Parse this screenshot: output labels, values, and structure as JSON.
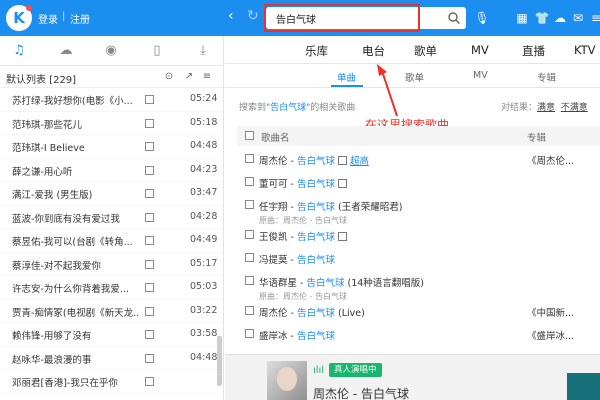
{
  "header": {
    "logo": "K",
    "login": "登录",
    "register": "注册",
    "search_value": "告白气球",
    "icons": [
      "mic-icon",
      "grid-icon",
      "skin-icon",
      "cloud-icon",
      "mail-icon",
      "menu-icon",
      "minimize-icon"
    ]
  },
  "left": {
    "tabs": [
      "music-note-icon",
      "cloud-icon",
      "radio-icon",
      "phone-icon",
      "download-icon"
    ],
    "list_title": "默认列表 [229]",
    "songs": [
      {
        "name": "苏打绿-我好想你(电影《小...",
        "dur": "05:24"
      },
      {
        "name": "范玮琪-那些花儿",
        "dur": "05:18"
      },
      {
        "name": "范玮琪-I Believe",
        "dur": "04:48"
      },
      {
        "name": "薛之谦-用心听",
        "dur": "04:23"
      },
      {
        "name": "满江-爱我 (男生版)",
        "dur": "03:47"
      },
      {
        "name": "蓝波-你到底有没有爱过我",
        "dur": "04:28"
      },
      {
        "name": "蔡昱佑-我可以(台剧《转角...",
        "dur": "04:49"
      },
      {
        "name": "蔡淳佳-对不起我爱你",
        "dur": "05:17"
      },
      {
        "name": "许志安-为什么你背着我爱...",
        "dur": "05:03"
      },
      {
        "name": "贾青-痴情冢(电视剧《新天龙...",
        "dur": "03:22"
      },
      {
        "name": "赖伟锋-用够了没有",
        "dur": "03:58"
      },
      {
        "name": "赵咏华-最浪漫的事",
        "dur": "04:48"
      },
      {
        "name": "邓丽君[香港]-我只在乎你",
        "dur": ""
      }
    ]
  },
  "main": {
    "tabs": [
      "乐库",
      "电台",
      "歌单",
      "MV",
      "直播",
      "KTV"
    ],
    "subtabs": [
      "单曲",
      "歌单",
      "MV",
      "专辑"
    ],
    "search_prefix": "搜索到",
    "search_kw": "\"告白气球\"",
    "search_suffix": "的相关歌曲",
    "result_right_label": "对结果：",
    "satisfied": "满意",
    "unsatisfied": "不满意",
    "note": "在这里搜索歌曲",
    "col_song": "歌曲名",
    "col_album": "专辑",
    "rows": [
      {
        "artist": "周杰伦 - ",
        "kw": "告白气球",
        "extra": "",
        "mv": true,
        "hq": "超高",
        "sub": "",
        "album": "《周杰伦..."
      },
      {
        "artist": "董可可 - ",
        "kw": "告白气球",
        "extra": "",
        "mv": true,
        "hq": "",
        "sub": "",
        "album": ""
      },
      {
        "artist": "任宇翔 - ",
        "kw": "告白气球",
        "extra": " (王者荣耀昭君)",
        "mv": false,
        "hq": "",
        "sub": "原曲：周杰伦 - 告白气球",
        "album": ""
      },
      {
        "artist": "王俊凯 - ",
        "kw": "告白气球",
        "extra": "",
        "mv": true,
        "hq": "",
        "sub": "",
        "album": ""
      },
      {
        "artist": "冯提莫 - ",
        "kw": "告白气球",
        "extra": "",
        "mv": false,
        "hq": "",
        "sub": "",
        "album": ""
      },
      {
        "artist": "华语群星 - ",
        "kw": "告白气球",
        "extra": " (14种语言翻唱版)",
        "mv": false,
        "hq": "",
        "sub": "原曲：周杰伦 - 告白气球",
        "album": ""
      },
      {
        "artist": "周杰伦 - ",
        "kw": "告白气球",
        "extra": " (Live)",
        "mv": false,
        "hq": "",
        "sub": "",
        "album": "《中国新..."
      },
      {
        "artist": "盛岸冰 - ",
        "kw": "告白气球",
        "extra": "",
        "mv": false,
        "hq": "",
        "sub": "",
        "album": "《盛岸冰..."
      }
    ]
  },
  "player": {
    "live_badge": "真人演唱中",
    "now_playing": "周杰伦 - 告白气球"
  }
}
